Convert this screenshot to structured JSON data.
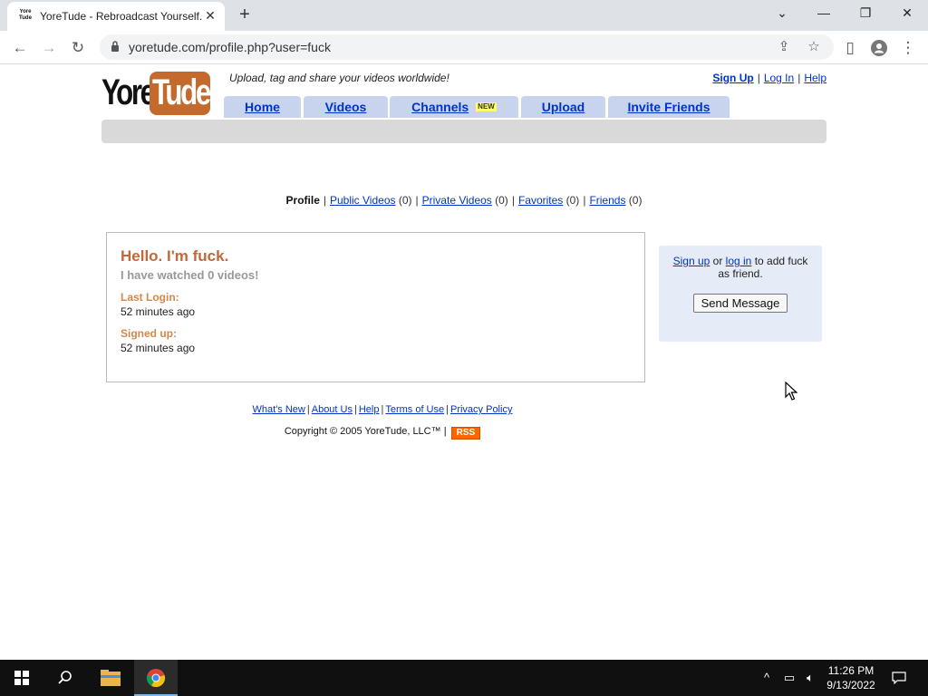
{
  "browser": {
    "tab_title": "YoreTude - Rebroadcast Yourself.",
    "favicon_text": "Yore Tude",
    "url": "yoretude.com/profile.php?user=fuck"
  },
  "site": {
    "logo_left": "Yore",
    "logo_right": "Tude",
    "tagline": "Upload, tag and share your videos worldwide!",
    "util_links": {
      "sign_up": "Sign Up",
      "log_in": "Log In",
      "help": "Help",
      "sep": "|"
    },
    "nav": [
      {
        "label": "Home"
      },
      {
        "label": "Videos"
      },
      {
        "label": "Channels",
        "badge": "NEW"
      },
      {
        "label": "Upload"
      },
      {
        "label": "Invite Friends"
      }
    ]
  },
  "subnav": {
    "profile": "Profile",
    "public_videos": "Public Videos",
    "public_count": "(0)",
    "private_videos": "Private Videos",
    "private_count": "(0)",
    "favorites": "Favorites",
    "favorites_count": "(0)",
    "friends": "Friends",
    "friends_count": "(0)",
    "sep": "|"
  },
  "profile": {
    "hello": "Hello. I'm fuck.",
    "watched": "I have watched 0 videos!",
    "last_login_label": "Last Login:",
    "last_login_value": "52 minutes ago",
    "signed_up_label": "Signed up:",
    "signed_up_value": "52 minutes ago"
  },
  "friend_box": {
    "sign_up": "Sign up",
    "or": "or",
    "log_in": "log in",
    "suffix": "to add fuck as friend.",
    "send_message": "Send Message"
  },
  "footer": {
    "whats_new": "What's New",
    "about_us": "About Us",
    "help": "Help",
    "terms": "Terms of Use",
    "privacy": "Privacy Policy",
    "sep": "|",
    "copyright": "Copyright © 2005 YoreTude, LLC™",
    "rss": "RSS"
  },
  "taskbar": {
    "time": "11:26 PM",
    "date": "9/13/2022"
  },
  "colors": {
    "link": "#0033cc",
    "logo_orange": "#c46a2c",
    "hello_orange": "#c0683a",
    "label_orange": "#d2884a",
    "nav_tab_bg": "#c8d3ee",
    "friend_box_bg": "#e6ebf8",
    "taskbar": "#101010"
  }
}
